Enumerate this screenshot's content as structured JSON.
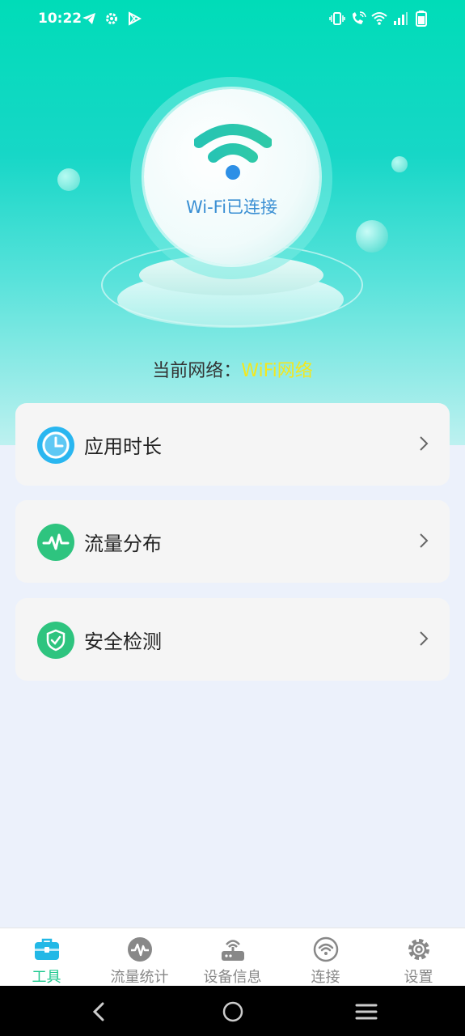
{
  "status_bar": {
    "time": "10:22",
    "left_icons": [
      "telegram-icon",
      "gear-icon",
      "play-store-icon"
    ],
    "right_icons": [
      "vibrate-icon",
      "wifi-call-icon",
      "wifi-icon",
      "signal-icon",
      "battery-icon"
    ]
  },
  "hero": {
    "status_text": "Wi-Fi已连接",
    "network_label": "当前网络：",
    "network_value": "WiFi网络"
  },
  "menu": [
    {
      "label": "应用时长",
      "icon": "clock-icon",
      "color": "#29b6f0"
    },
    {
      "label": "流量分布",
      "icon": "pulse-icon",
      "color": "#2ec47f"
    },
    {
      "label": "安全检测",
      "icon": "shield-check-icon",
      "color": "#2ec47f"
    }
  ],
  "tabs": [
    {
      "label": "工具",
      "icon": "toolbox-icon",
      "active": true
    },
    {
      "label": "流量统计",
      "icon": "pulse-circle-icon",
      "active": false
    },
    {
      "label": "设备信息",
      "icon": "router-icon",
      "active": false
    },
    {
      "label": "连接",
      "icon": "wifi-circle-icon",
      "active": false
    },
    {
      "label": "设置",
      "icon": "gear-icon",
      "active": false
    }
  ],
  "colors": {
    "accent": "#1ec88f",
    "tab_inactive": "#888888",
    "network_value": "#f3e81d",
    "wifi_text": "#3a8fd3"
  }
}
